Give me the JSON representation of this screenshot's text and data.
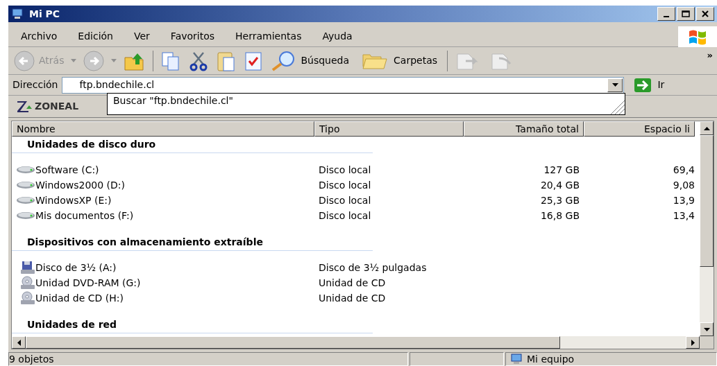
{
  "window": {
    "title": "Mi PC"
  },
  "menu": [
    "Archivo",
    "Edición",
    "Ver",
    "Favoritos",
    "Herramientas",
    "Ayuda"
  ],
  "toolbar": {
    "back": "Atrás",
    "search": "Búsqueda",
    "folders": "Carpetas",
    "overflow": "»"
  },
  "address": {
    "label": "Dirección",
    "value": "ftp.bndechile.cl",
    "go": "Ir",
    "suggestion": "Buscar \"ftp.bndechile.cl\""
  },
  "zonealarm": {
    "text": "ZONEAL"
  },
  "table": {
    "columns": [
      "Nombre",
      "Tipo",
      "Tamaño total",
      "Espacio li"
    ],
    "groups": [
      {
        "title": "Unidades de disco duro",
        "rows": [
          {
            "kind": "hdd",
            "name": "Software (C:)",
            "type": "Disco local",
            "total": "127 GB",
            "free": "69,4"
          },
          {
            "kind": "hdd",
            "name": "Windows2000 (D:)",
            "type": "Disco local",
            "total": "20,4 GB",
            "free": "9,08"
          },
          {
            "kind": "hdd",
            "name": "WindowsXP (E:)",
            "type": "Disco local",
            "total": "25,3 GB",
            "free": "13,9"
          },
          {
            "kind": "hdd",
            "name": "Mis documentos (F:)",
            "type": "Disco local",
            "total": "16,8 GB",
            "free": "13,4"
          }
        ]
      },
      {
        "title": "Dispositivos con almacenamiento extraíble",
        "rows": [
          {
            "kind": "floppy",
            "name": "Disco de 3½ (A:)",
            "type": "Disco de 3½ pulgadas"
          },
          {
            "kind": "cd",
            "name": "Unidad DVD-RAM (G:)",
            "type": "Unidad de CD"
          },
          {
            "kind": "cd",
            "name": "Unidad de CD (H:)",
            "type": "Unidad de CD"
          }
        ]
      },
      {
        "title": "Unidades de red"
      }
    ]
  },
  "status_bar": {
    "count": "9 objetos",
    "location": "Mi equipo"
  }
}
